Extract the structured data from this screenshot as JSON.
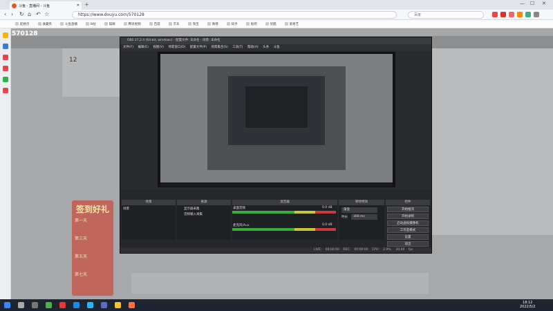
{
  "browser": {
    "tab_title": "斗鱼 - 直播间 - 斗鱼",
    "new_tab": "+",
    "url": "https://www.douyu.com/570128",
    "search_placeholder": "百度",
    "window_controls": [
      "—",
      "☐",
      "✕"
    ],
    "bookmarks": [
      "起始页",
      "收藏夹",
      "斗鱼直播",
      "B站",
      "猫眼",
      "腾讯视频",
      "百度",
      "京东",
      "淘宝",
      "微博",
      "知乎",
      "贴吧",
      "优酷",
      "爱奇艺"
    ]
  },
  "page": {
    "room_id": "570128",
    "fav_count": "12",
    "signin": {
      "title": "签到好礼",
      "days": [
        "第一天",
        "第三天",
        "第五天",
        "第七天"
      ]
    }
  },
  "obs": {
    "title": "OBS 27.2.4 (64-bit, windows) - 配置文件: 未命名 - 场景: 未命名",
    "menu": "文件(F) 编辑(E) 视图(V) 停靠窗口(D) 配置文件(P) 场景集合(S) 工具(T) 帮助(H) 头条 斗鱼",
    "panels": {
      "scenes": "场景",
      "sources": "来源",
      "mixer": "混音器",
      "transitions": "转场特效",
      "controls": "控件"
    },
    "scene_item": "场景",
    "sources": [
      "显示器采集",
      "音频输入采集"
    ],
    "mixer": [
      {
        "name": "桌面音频",
        "db": "0.0 dB"
      },
      {
        "name": "麦克风/Aux",
        "db": "0.0 dB"
      }
    ],
    "transition": {
      "type": "渐变",
      "duration_label": "时长",
      "duration": "300 ms"
    },
    "controls": [
      "开始推流",
      "开始录制",
      "启动虚拟摄像机",
      "工作室模式",
      "设置",
      "退出"
    ],
    "status": "LIVE: 00:00:00 REC: 00:00:00 CPU: 2.9%, 30.00 fps"
  },
  "taskbar": {
    "time": "18:12",
    "date": "2022/5/2"
  },
  "colors": {
    "accent": "#e4572e",
    "obs_bg": "#2a2b2e",
    "signin": "#c0665c"
  }
}
